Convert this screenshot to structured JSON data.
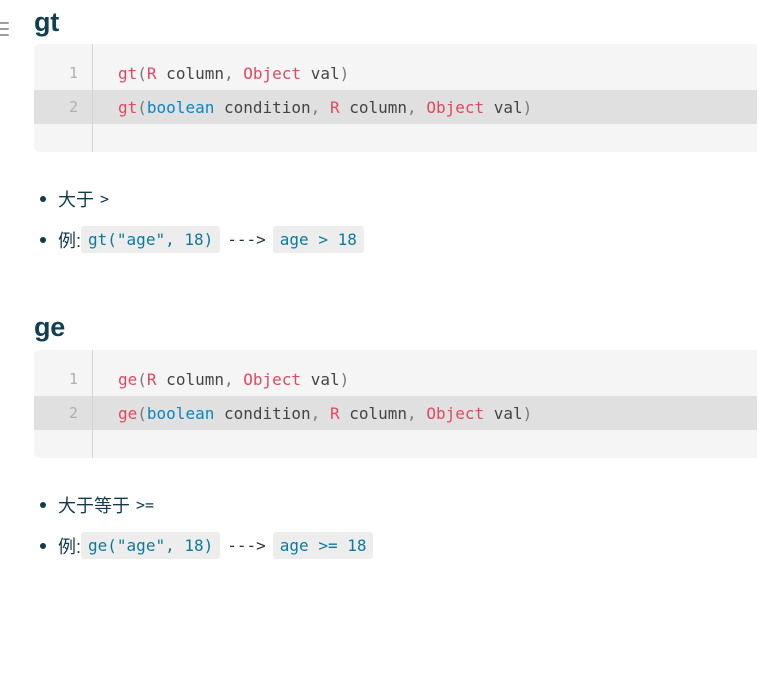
{
  "nav": {
    "menu_icon": "hamburger-menu-icon"
  },
  "sections": [
    {
      "title": "gt",
      "code": {
        "lines": [
          {
            "number": "1",
            "tokens": [
              {
                "t": "gt",
                "c": "fn"
              },
              {
                "t": "(",
                "c": "punct"
              },
              {
                "t": "R",
                "c": "type"
              },
              {
                "t": " column",
                "c": "plain"
              },
              {
                "t": ",",
                "c": "punct"
              },
              {
                "t": " ",
                "c": "plain"
              },
              {
                "t": "Object",
                "c": "type"
              },
              {
                "t": " val",
                "c": "plain"
              },
              {
                "t": ")",
                "c": "punct"
              }
            ],
            "highlighted": false
          },
          {
            "number": "2",
            "tokens": [
              {
                "t": "gt",
                "c": "fn"
              },
              {
                "t": "(",
                "c": "punct"
              },
              {
                "t": "boolean",
                "c": "kw"
              },
              {
                "t": " condition",
                "c": "plain"
              },
              {
                "t": ",",
                "c": "punct"
              },
              {
                "t": " ",
                "c": "plain"
              },
              {
                "t": "R",
                "c": "type"
              },
              {
                "t": " column",
                "c": "plain"
              },
              {
                "t": ",",
                "c": "punct"
              },
              {
                "t": " ",
                "c": "plain"
              },
              {
                "t": "Object",
                "c": "type"
              },
              {
                "t": " val",
                "c": "plain"
              },
              {
                "t": ")",
                "c": "punct"
              }
            ],
            "highlighted": true
          }
        ]
      },
      "bullets": [
        {
          "kind": "desc",
          "label": "大于",
          "operator": ">"
        },
        {
          "kind": "example",
          "label": "例:",
          "call": "gt(\"age\", 18)",
          "arrow": "--->",
          "result": "age > 18"
        }
      ]
    },
    {
      "title": "ge",
      "code": {
        "lines": [
          {
            "number": "1",
            "tokens": [
              {
                "t": "ge",
                "c": "fn"
              },
              {
                "t": "(",
                "c": "punct"
              },
              {
                "t": "R",
                "c": "type"
              },
              {
                "t": " column",
                "c": "plain"
              },
              {
                "t": ",",
                "c": "punct"
              },
              {
                "t": " ",
                "c": "plain"
              },
              {
                "t": "Object",
                "c": "type"
              },
              {
                "t": " val",
                "c": "plain"
              },
              {
                "t": ")",
                "c": "punct"
              }
            ],
            "highlighted": false
          },
          {
            "number": "2",
            "tokens": [
              {
                "t": "ge",
                "c": "fn"
              },
              {
                "t": "(",
                "c": "punct"
              },
              {
                "t": "boolean",
                "c": "kw"
              },
              {
                "t": " condition",
                "c": "plain"
              },
              {
                "t": ",",
                "c": "punct"
              },
              {
                "t": " ",
                "c": "plain"
              },
              {
                "t": "R",
                "c": "type"
              },
              {
                "t": " column",
                "c": "plain"
              },
              {
                "t": ",",
                "c": "punct"
              },
              {
                "t": " ",
                "c": "plain"
              },
              {
                "t": "Object",
                "c": "type"
              },
              {
                "t": " val",
                "c": "plain"
              },
              {
                "t": ")",
                "c": "punct"
              }
            ],
            "highlighted": true
          }
        ]
      },
      "bullets": [
        {
          "kind": "desc",
          "label": "大于等于",
          "operator": ">="
        },
        {
          "kind": "example",
          "label": "例:",
          "call": "ge(\"age\", 18)",
          "arrow": "--->",
          "result": "age >= 18"
        }
      ]
    }
  ],
  "colors": {
    "heading": "#0e3f52",
    "code_bg": "#f5f5f5",
    "code_highlight_bg": "#e0e0e0",
    "chip_bg": "#ededed",
    "chip_text": "#0b7a9e",
    "token_function": "#e0485f",
    "token_keyword": "#0b84c4",
    "body_text": "#12394c"
  }
}
